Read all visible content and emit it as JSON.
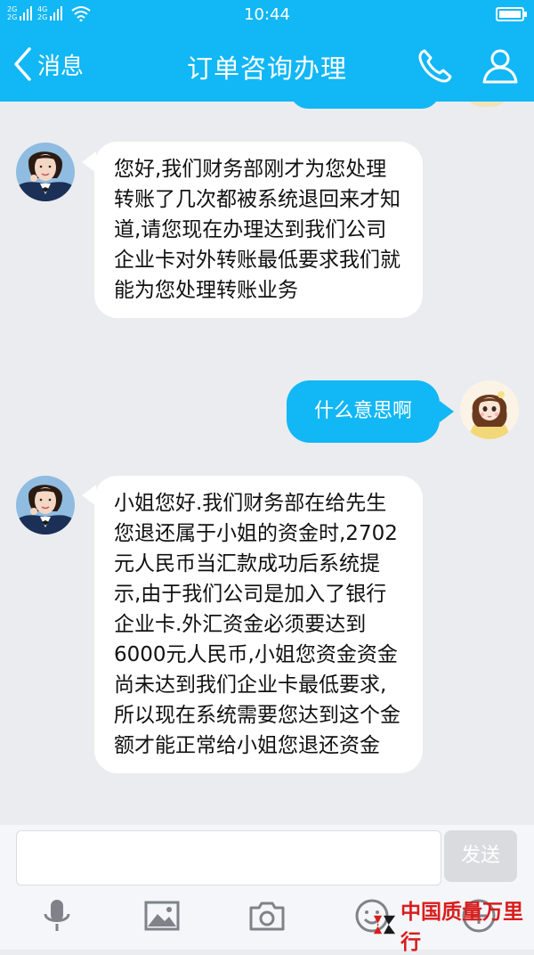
{
  "status_bar": {
    "time": "10:44",
    "signal_top": "2G",
    "signal_bottom": "2G",
    "network_top": "4G",
    "network_bottom": "2G"
  },
  "nav": {
    "back_label": "消息",
    "title": "订单咨询办理",
    "icons": [
      "phone-icon",
      "profile-icon"
    ]
  },
  "messages": [
    {
      "direction": "incoming",
      "text": "您好,我们财务部刚才为您处理转账了几次都被系统退回来才知道,请您现在办理达到我们公司企业卡对外转账最低要求我们就能为您处理转账业务"
    },
    {
      "direction": "outgoing",
      "text": "什么意思啊"
    },
    {
      "direction": "incoming",
      "text": "小姐您好.我们财务部在给先生您退还属于小姐的资金时,2702元人民币当汇款成功后系统提示,由于我们公司是加入了银行企业卡.外汇资金必须要达到6000元人民币,小姐您资金资金尚未达到我们企业卡最低要求,所以现在系统需要您达到这个金额才能正常给小姐您退还资金"
    }
  ],
  "input": {
    "placeholder": "",
    "send_label": "发送"
  },
  "toolbar": {
    "icons": [
      "microphone-icon",
      "image-icon",
      "camera-icon",
      "emoji-icon",
      "more-icon"
    ]
  },
  "watermark": {
    "text": "中国质量万里行"
  },
  "colors": {
    "accent": "#12b7f5",
    "chat_background": "#ebecf0",
    "incoming_bubble": "#ffffff",
    "outgoing_bubble": "#12b7f5",
    "watermark_red": "#d81d1d"
  }
}
